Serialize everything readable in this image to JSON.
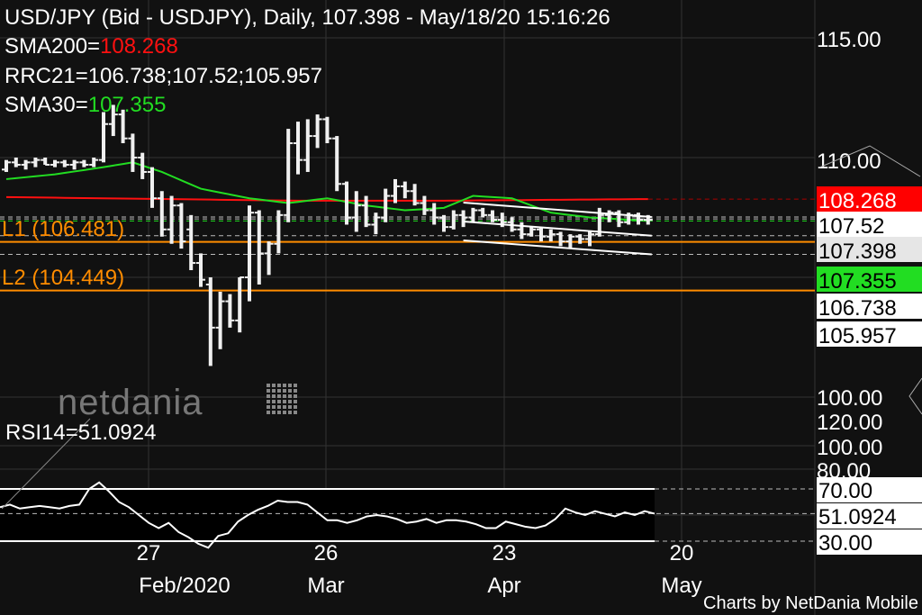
{
  "header": {
    "title": "USD/JPY (Bid - USDJPY),  Daily, 107.398 - May/18/20 15:16:26",
    "sma200_label": "SMA200=",
    "sma200_value": "108.268",
    "rrc_label": "RRC21=106.738;107.52;105.957",
    "sma30_label": "SMA30=",
    "sma30_value": "107.355"
  },
  "levels": {
    "l1_label": "L1 (106.481)",
    "l1": 106.481,
    "l2_label": "L2 (104.449)",
    "l2": 104.449
  },
  "logo": "netdania",
  "footer": "Charts by NetDania Mobile",
  "price_axis": [
    "115.00",
    "110.00",
    "100.00"
  ],
  "price_tags": [
    {
      "text": "108.268",
      "bg": "#ff0000",
      "fg": "#ffffff"
    },
    {
      "text": "107.52",
      "bg": "#ffffff",
      "fg": "#000000"
    },
    {
      "text": "107.398",
      "bg": "#e6e6e6",
      "fg": "#000000"
    },
    {
      "text": "107.355",
      "bg": "#22dd22",
      "fg": "#000000"
    },
    {
      "text": "106.738",
      "bg": "#ffffff",
      "fg": "#000000"
    },
    {
      "text": "105.957",
      "bg": "#ffffff",
      "fg": "#000000"
    }
  ],
  "rsi": {
    "label": "RSI14=51.0924",
    "axis": [
      "120.00",
      "100.00",
      "80.00"
    ],
    "tags": [
      "70.00",
      "51.0924",
      "30.00"
    ]
  },
  "x_axis": {
    "days": [
      "27",
      "26",
      "23",
      "20"
    ],
    "months": [
      "Feb/2020",
      "Mar",
      "Apr",
      "May"
    ]
  },
  "colors": {
    "sma200": "#ff1010",
    "sma30": "#22dd22",
    "level": "#ff8c00",
    "bar": "#f0f0f0"
  },
  "chart_data": {
    "type": "ohlc",
    "title": "USD/JPY Daily",
    "ylim": [
      99.5,
      115.5
    ],
    "ohlc": [
      [
        109.5,
        109.9,
        109.4,
        109.8
      ],
      [
        109.8,
        110.0,
        109.6,
        109.7
      ],
      [
        109.7,
        109.9,
        109.5,
        109.8
      ],
      [
        109.8,
        110.0,
        109.6,
        109.9
      ],
      [
        109.9,
        110.0,
        109.7,
        109.7
      ],
      [
        109.7,
        109.9,
        109.6,
        109.8
      ],
      [
        109.8,
        109.9,
        109.6,
        109.7
      ],
      [
        109.7,
        109.9,
        109.5,
        109.8
      ],
      [
        109.8,
        109.9,
        109.6,
        109.7
      ],
      [
        109.7,
        110.0,
        109.6,
        109.9
      ],
      [
        109.9,
        111.9,
        109.8,
        111.4
      ],
      [
        111.4,
        112.2,
        110.9,
        111.8
      ],
      [
        111.8,
        112.0,
        110.6,
        110.8
      ],
      [
        110.8,
        111.0,
        109.4,
        110.0
      ],
      [
        110.0,
        110.2,
        109.1,
        109.4
      ],
      [
        109.4,
        109.6,
        107.9,
        108.3
      ],
      [
        108.3,
        108.6,
        106.7,
        107.0
      ],
      [
        107.0,
        108.4,
        106.4,
        108.0
      ],
      [
        108.0,
        108.1,
        106.2,
        106.5
      ],
      [
        107.0,
        107.6,
        105.3,
        105.6
      ],
      [
        105.6,
        106.0,
        104.6,
        104.9
      ],
      [
        104.7,
        105.0,
        101.3,
        102.9
      ],
      [
        102.9,
        104.4,
        102.0,
        104.0
      ],
      [
        104.0,
        104.3,
        102.9,
        103.2
      ],
      [
        103.2,
        105.0,
        102.7,
        105.0
      ],
      [
        105.0,
        108.0,
        104.0,
        107.7
      ],
      [
        107.7,
        107.8,
        104.7,
        106.0
      ],
      [
        106.0,
        106.5,
        105.1,
        106.4
      ],
      [
        106.4,
        107.8,
        106.0,
        107.6
      ],
      [
        107.6,
        111.2,
        107.3,
        110.6
      ],
      [
        110.6,
        111.5,
        109.3,
        109.9
      ],
      [
        109.9,
        111.6,
        109.4,
        110.9
      ],
      [
        110.9,
        111.8,
        110.4,
        111.6
      ],
      [
        111.6,
        111.7,
        110.6,
        110.8
      ],
      [
        110.8,
        110.9,
        108.6,
        108.9
      ],
      [
        108.9,
        109.0,
        107.2,
        107.5
      ],
      [
        107.5,
        108.6,
        106.9,
        108.0
      ],
      [
        108.0,
        108.4,
        107.1,
        107.2
      ],
      [
        107.2,
        107.7,
        106.8,
        107.5
      ],
      [
        107.5,
        108.7,
        107.3,
        108.4
      ],
      [
        108.4,
        109.1,
        108.1,
        108.8
      ],
      [
        108.8,
        109.0,
        108.3,
        108.6
      ],
      [
        108.6,
        108.9,
        108.0,
        108.1
      ],
      [
        108.1,
        108.4,
        107.6,
        107.8
      ],
      [
        107.8,
        108.1,
        107.2,
        107.5
      ],
      [
        107.5,
        107.6,
        106.9,
        107.1
      ],
      [
        107.1,
        107.8,
        107.0,
        107.6
      ],
      [
        107.6,
        107.8,
        107.1,
        107.5
      ],
      [
        107.5,
        107.9,
        107.3,
        107.8
      ],
      [
        107.8,
        107.9,
        107.5,
        107.6
      ],
      [
        107.6,
        107.8,
        107.3,
        107.4
      ],
      [
        107.4,
        107.7,
        107.1,
        107.3
      ],
      [
        107.3,
        107.5,
        106.9,
        107.0
      ],
      [
        107.0,
        107.3,
        106.6,
        106.8
      ],
      [
        106.8,
        107.1,
        106.7,
        107.0
      ],
      [
        107.0,
        107.1,
        106.5,
        106.7
      ],
      [
        106.7,
        107.0,
        106.5,
        106.8
      ],
      [
        106.8,
        106.9,
        106.3,
        106.5
      ],
      [
        106.5,
        106.8,
        106.2,
        106.7
      ],
      [
        106.7,
        106.8,
        106.4,
        106.6
      ],
      [
        106.6,
        106.9,
        106.3,
        106.8
      ],
      [
        106.8,
        107.9,
        106.7,
        107.6
      ],
      [
        107.6,
        107.8,
        107.3,
        107.7
      ],
      [
        107.7,
        107.8,
        107.1,
        107.3
      ],
      [
        107.3,
        107.7,
        107.2,
        107.6
      ],
      [
        107.6,
        107.7,
        107.2,
        107.4
      ],
      [
        107.4,
        107.6,
        107.2,
        107.4
      ]
    ],
    "sma30_knots": [
      [
        0,
        109.1
      ],
      [
        5,
        109.3
      ],
      [
        10,
        109.6
      ],
      [
        13,
        109.8
      ],
      [
        16,
        109.4
      ],
      [
        20,
        108.7
      ],
      [
        25,
        108.3
      ],
      [
        29,
        108.1
      ],
      [
        33,
        108.3
      ],
      [
        37,
        108.0
      ],
      [
        41,
        107.8
      ],
      [
        45,
        107.9
      ],
      [
        48,
        108.4
      ],
      [
        52,
        108.3
      ],
      [
        56,
        107.7
      ],
      [
        60,
        107.5
      ],
      [
        66,
        107.355
      ]
    ],
    "sma200_knots": [
      [
        0,
        108.35
      ],
      [
        30,
        108.2
      ],
      [
        45,
        108.2
      ],
      [
        66,
        108.268
      ]
    ],
    "rrc21": {
      "start_index": 47,
      "end_index": 66,
      "upper": [
        108.12,
        107.52
      ],
      "mid": [
        107.33,
        106.738
      ],
      "lower": [
        106.54,
        105.957
      ]
    },
    "rsi14": [
      56,
      58,
      55,
      56,
      57,
      56,
      55,
      57,
      58,
      70,
      75,
      68,
      60,
      56,
      50,
      44,
      40,
      44,
      37,
      33,
      28,
      25,
      34,
      36,
      45,
      50,
      54,
      57,
      61,
      60,
      60,
      58,
      52,
      46,
      46,
      44,
      46,
      49,
      50,
      49,
      47,
      44,
      45,
      47,
      44,
      46,
      46,
      45,
      43,
      40,
      40,
      45,
      43,
      41,
      40,
      42,
      47,
      55,
      52,
      50,
      53,
      51,
      49,
      52,
      50,
      53,
      51.09
    ],
    "rsi_levels": [
      70,
      30
    ]
  }
}
